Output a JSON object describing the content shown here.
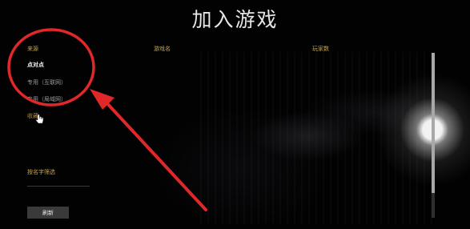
{
  "window": {
    "title": "加入游戏"
  },
  "columns": {
    "source": "来源",
    "game_name": "游戏名",
    "players": "玩家数"
  },
  "sidebar": {
    "items": [
      {
        "label": "点对点"
      },
      {
        "label": "专用（互联网）"
      },
      {
        "label": "专用（局域网）"
      },
      {
        "label": "收藏"
      }
    ],
    "filter_label": "按名字筛选",
    "refresh_label": "刷新"
  },
  "scrollbar": {
    "visible_fraction": 0.85
  },
  "colors": {
    "accent": "#c8a53f",
    "annotation": "#e0282a",
    "background": "#020203"
  }
}
